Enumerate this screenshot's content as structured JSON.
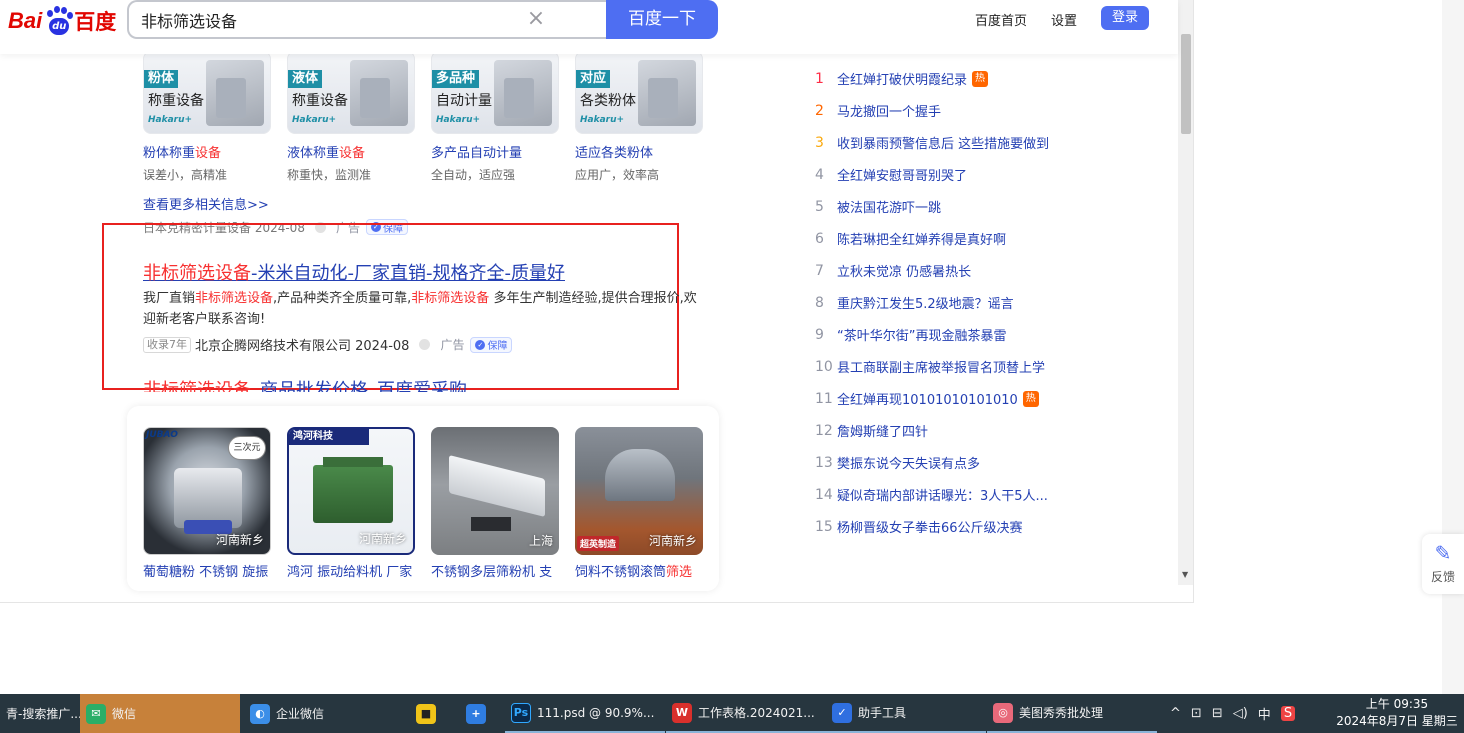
{
  "header": {
    "logo_bai": "Bai",
    "logo_du": "du",
    "logo_cn": "百度",
    "search_value": "非标筛选设备",
    "search_button": "百度一下",
    "links": [
      "百度首页",
      "设置"
    ],
    "login": "登录"
  },
  "products": [
    {
      "tag1": "粉体",
      "tag2": "称重设备",
      "brand": "Hakaru+",
      "title_a": "粉体称重",
      "title_hl": "设备",
      "desc": "误差小，高精准"
    },
    {
      "tag1": "液体",
      "tag2": "称重设备",
      "brand": "Hakaru+",
      "title_a": "液体称重",
      "title_hl": "设备",
      "desc": "称重快，监测准"
    },
    {
      "tag1": "多品种",
      "tag2": "自动计量",
      "brand": "Hakaru+",
      "title_a": "多产品自动计量",
      "title_hl": "",
      "desc": "全自动，适应强"
    },
    {
      "tag1": "对应",
      "tag2": "各类粉体",
      "brand": "Hakaru+",
      "title_a": "适应各类粉体",
      "title_hl": "",
      "desc": "应用广，效率高"
    }
  ],
  "more_link": "查看更多相关信息>>",
  "ad1_source": "日本克精密计量设备 2024-08",
  "ad_label": "广告",
  "guarantee": "保障",
  "main_ad": {
    "title_hl": "非标筛选设备",
    "title_rest": "-米米自动化-厂家直销-规格齐全-质量好",
    "desc_1": "我厂直销",
    "desc_hl1": "非标筛选设备",
    "desc_2": ",产品种类齐全质量可靠,",
    "desc_hl2": "非标筛选设备",
    "desc_3": " 多年生产制造经验,提供合理报价,欢迎新老客户联系咨询!",
    "years": "收录7年",
    "source": "北京企腾网络技术有限公司 2024-08",
    "ad_label": "广告",
    "guarantee": "保障"
  },
  "second_ad": {
    "title_hl": "非标筛选设备",
    "title_rest": "_商品批发价格_百度爱采购"
  },
  "photos": [
    {
      "loc": "河南新乡",
      "title_a": "葡萄糖粉 不锈钢 旋振",
      "title_hl": "",
      "brand": "JUBAO",
      "badge": "三次元"
    },
    {
      "loc": "河南新乡",
      "title_a": "鸿河 振动给料机 厂家",
      "title_hl": "",
      "brand": "鸿河科技",
      "badge": ""
    },
    {
      "loc": "上海",
      "title_a": "不锈钢多层筛粉机 支",
      "title_hl": "",
      "brand": "",
      "badge": ""
    },
    {
      "loc": "河南新乡",
      "title_a": "饲料不锈钢滚筒",
      "title_hl": "筛选",
      "brand": "超英制造",
      "badge": ""
    }
  ],
  "hot_list": [
    {
      "num": "1",
      "text": "全红婵打破伏明霞纪录",
      "hot": true
    },
    {
      "num": "2",
      "text": "马龙撤回一个握手",
      "hot": false
    },
    {
      "num": "3",
      "text": "收到暴雨预警信息后 这些措施要做到",
      "hot": false
    },
    {
      "num": "4",
      "text": "全红婵安慰哥哥别哭了",
      "hot": false
    },
    {
      "num": "5",
      "text": "被法国花游吓一跳",
      "hot": false
    },
    {
      "num": "6",
      "text": "陈若琳把全红婵养得是真好啊",
      "hot": false
    },
    {
      "num": "7",
      "text": "立秋未觉凉 仍感暑热长",
      "hot": false
    },
    {
      "num": "8",
      "text": "重庆黔江发生5.2级地震？谣言",
      "hot": false
    },
    {
      "num": "9",
      "text": "“茶叶华尔街”再现金融茶暴雷",
      "hot": false
    },
    {
      "num": "10",
      "text": "县工商联副主席被举报冒名顶替上学",
      "hot": false
    },
    {
      "num": "11",
      "text": "全红婵再现10101010101010",
      "hot": true
    },
    {
      "num": "12",
      "text": "詹姆斯缝了四针",
      "hot": false
    },
    {
      "num": "13",
      "text": "樊振东说今天失误有点多",
      "hot": false
    },
    {
      "num": "14",
      "text": "疑似奇瑞内部讲话曝光：3人干5人...",
      "hot": false
    },
    {
      "num": "15",
      "text": "杨柳晋级女子拳击66公斤级决赛",
      "hot": false
    }
  ],
  "hot_tag": "热",
  "feedback": "反馈",
  "taskbar": {
    "items": [
      {
        "label": "青-搜索推广...",
        "icon": "",
        "color": "#3a6ea5"
      },
      {
        "label": "微信",
        "icon": "✉",
        "color": "#2aae67"
      },
      {
        "label": "企业微信",
        "icon": "◐",
        "color": "#3b8ee8"
      },
      {
        "label": "",
        "icon": "■",
        "color": "#f0c419"
      },
      {
        "label": "",
        "icon": "+",
        "color": "#2f7de1"
      },
      {
        "label": "111.psd @ 90.9%...",
        "icon": "Ps",
        "color": "#0b2a4a"
      },
      {
        "label": "工作表格.2024021...",
        "icon": "W",
        "color": "#d9302c"
      },
      {
        "label": "助手工具",
        "icon": "✓",
        "color": "#2f6fe0"
      },
      {
        "label": "美图秀秀批处理",
        "icon": "◎",
        "color": "#e8697a"
      }
    ],
    "tray": [
      "^",
      "⊡",
      "⊟",
      "◁)",
      "中",
      "S"
    ],
    "time": "上午 09:35",
    "date": "2024年8月7日 星期三"
  }
}
